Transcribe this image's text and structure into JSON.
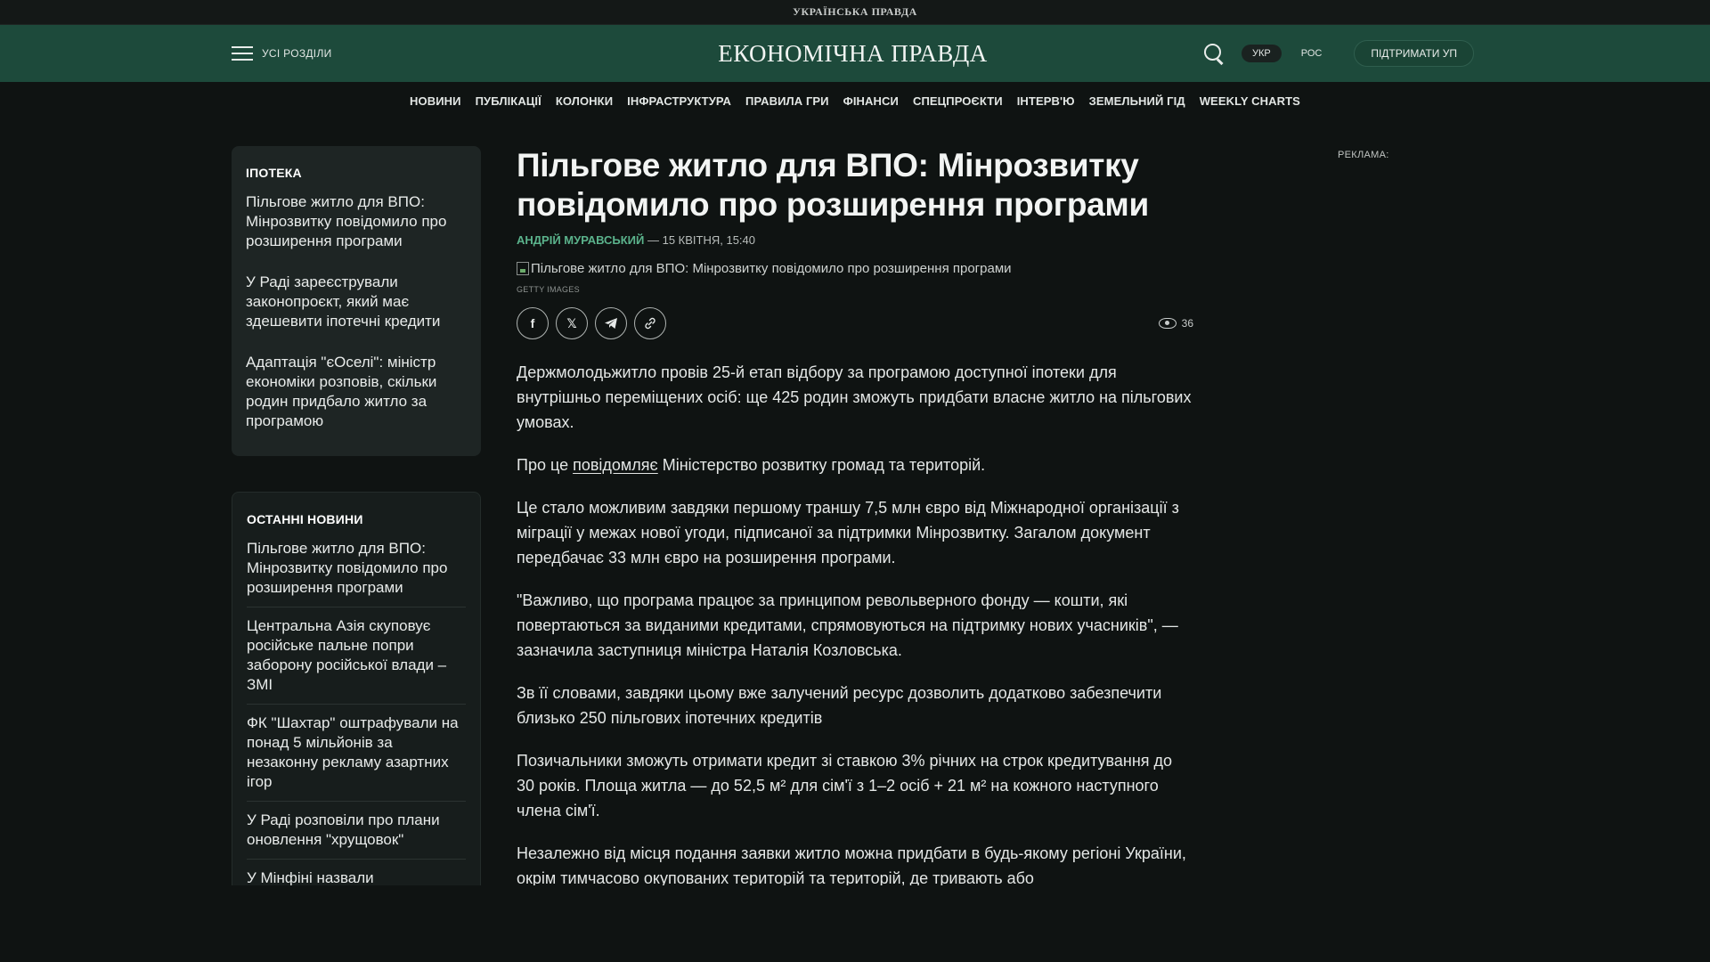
{
  "top_strip": {
    "brand": "УКРАЇНСЬКА ПРАВДА"
  },
  "header": {
    "menu_label": "УСІ РОЗДІЛИ",
    "logo": "ЕКОНОМІЧНА ПРАВДА",
    "lang_ukr": "УКР",
    "lang_ros": "РОС",
    "support": "ПІДТРИМАТИ УП"
  },
  "nav": {
    "items": [
      "НОВИНИ",
      "ПУБЛІКАЦІЇ",
      "КОЛОНКИ",
      "ІНФРАСТРУКТУРА",
      "ПРАВИЛА ГРИ",
      "ФІНАНСИ",
      "СПЕЦПРОЄКТИ",
      "ІНТЕРВ'Ю",
      "ЗЕМЕЛЬНИЙ ГІД",
      "WEEKLY CHARTS"
    ]
  },
  "sidebar": {
    "ipoteka": {
      "title": "ІПОТЕКА",
      "items": [
        "Пільгове житло для ВПО: Мінрозвитку повідомило про розширення програми",
        "У Раді зареєстрували законопроєкт, який має здешевити іпотечні кредити",
        "Адаптація \"єОселі\": міністр економіки розповів, скільки родин придбало житло за програмою"
      ]
    },
    "latest": {
      "title": "ОСТАННІ НОВИНИ",
      "items": [
        "Пільгове житло для ВПО: Мінрозвитку повідомило про розширення програми",
        "Центральна Азія скуповує російське пальне попри заборону російської влади – ЗМІ",
        "ФК \"Шахтар\" оштрафували на понад 5 мільйонів за незаконну рекламу азартних ігор",
        "У Раді розповіли про плани оновлення \"хрущовок\"",
        "У Мінфіні назвали"
      ]
    }
  },
  "article": {
    "title": "Пільгове житло для ВПО: Мінрозвитку повідомило про розширення програми",
    "author": "АНДРІЙ МУРАВСЬКИЙ",
    "date": "— 15 КВІТНЯ, 15:40",
    "image_alt": "Пільгове житло для ВПО: Мінрозвитку повідомило про розширення програми",
    "caption": "GETTY IMAGES",
    "views": "36",
    "p1": "Держмолодьжитло провів 25-й етап відбору за програмою доступної іпотеки для внутрішньо переміщених осіб: ще 425 родин зможуть придбати власне житло на пільгових умовах.",
    "p2_before": "Про це ",
    "p2_link": "повідомляє",
    "p2_after": " Міністерство розвитку громад та територій.",
    "p3": "Це стало можливим завдяки першому траншу 7,5 млн євро від Міжнародної організації з міграції у межах нової угоди, підписаної за підтримки Мінрозвитку. Загалом документ передбачає 33 млн євро на розширення програми.",
    "p4": "\"Важливо, що програма працює за принципом револьверного фонду — кошти, які повертаються за виданими кредитами, спрямовуються на підтримку нових учасників\", — зазначила заступниця міністра Наталія Козловська.",
    "p5": "Зв її словами, завдяки цьому вже залучений ресурс дозволить додатково забезпечити близько 250 пільгових іпотечних кредитів",
    "p6": "Позичальники зможуть отримати кредит зі ставкою 3% річних на строк кредитування до 30 років. Площа житла — до 52,5 м² для сім'ї з 1–2 осіб + 21 м² на кожного наступного члена сім'ї.",
    "p7": "Незалежно від місця подання заявки житло можна придбати в будь-якому регіоні України, окрім тимчасово окупованих територій та територій, де тривають або"
  },
  "ad": {
    "label": "РЕКЛАМА:"
  }
}
